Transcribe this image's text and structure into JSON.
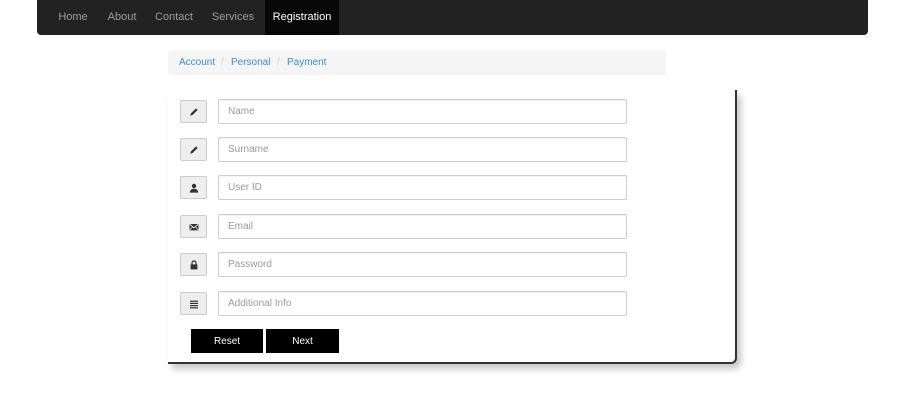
{
  "nav": {
    "items": [
      {
        "label": "Home"
      },
      {
        "label": "About"
      },
      {
        "label": "Contact"
      },
      {
        "label": "Services"
      },
      {
        "label": "Registration"
      }
    ],
    "active": "Registration"
  },
  "breadcrumb": {
    "items": [
      "Account",
      "Personal",
      "Payment"
    ],
    "separator": "/"
  },
  "form": {
    "fields": [
      {
        "placeholder": "Name",
        "value": "",
        "icon": "pencil-icon"
      },
      {
        "placeholder": "Surname",
        "value": "",
        "icon": "pencil-icon"
      },
      {
        "placeholder": "User ID",
        "value": "",
        "icon": "user-icon"
      },
      {
        "placeholder": "Email",
        "value": "",
        "icon": "envelope-icon"
      },
      {
        "placeholder": "Password",
        "value": "",
        "icon": "lock-icon"
      },
      {
        "placeholder": "Additional Info",
        "value": "",
        "icon": "list-icon"
      }
    ],
    "reset_label": "Reset",
    "next_label": "Next"
  },
  "colors": {
    "navbar_bg": "#222222",
    "navbar_active_bg": "#080808",
    "link": "#428bca",
    "button_bg": "#000000"
  }
}
